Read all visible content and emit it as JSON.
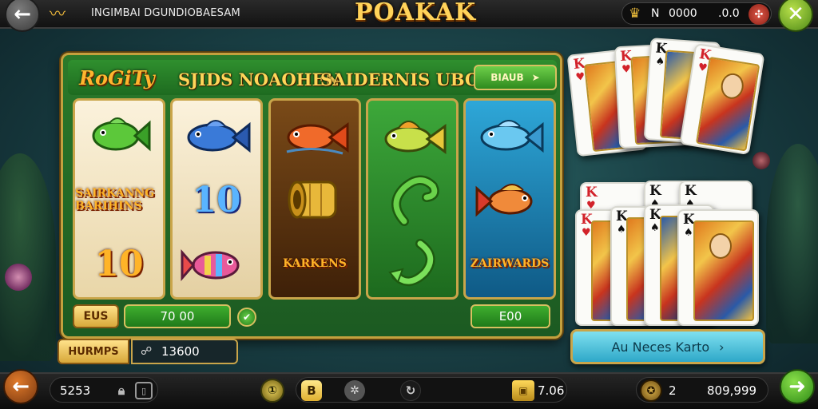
{
  "header": {
    "back_icon": "arrow-left-icon",
    "subtitle": "INGIMBAI DGUNDIOBAESAM",
    "title": "POAKAK",
    "balance_letter": "N",
    "balance_value": "0000",
    "balance_value2": ".0.0",
    "close_icon": "close-x-icon"
  },
  "panel": {
    "logo": "RoGiTy",
    "title": "SJIDS NOAOHEN",
    "title2": "SAIDERNIS UBOS",
    "menu_button": "BIAUB",
    "reels": [
      [
        "fish-green",
        "SAIRKANNG BARIHINS",
        "10"
      ],
      [
        "fish-blue",
        "10",
        "fish-rainbow"
      ],
      [
        "fish-orange",
        "gold-coin",
        "KARKENS"
      ],
      [
        "fish-yellow",
        "hook-green",
        "hook-green"
      ],
      [
        "fish-blue",
        "fish-red",
        "ZAIRWARDS"
      ]
    ],
    "bet_label": "EUS",
    "bet_value": "70 00",
    "win_value": "E00",
    "lower_label": "HURMPS",
    "lower_value": "13600"
  },
  "cards": {
    "rank": "K",
    "cta_label": "Au Neces Karto"
  },
  "footer": {
    "left_value": "5253",
    "b_label": "B",
    "chest_value": "7.06",
    "count_value": "2",
    "coins_value": "809,999"
  },
  "colors": {
    "accent_gold": "#ffd35a",
    "panel_green": "#2b7a2a",
    "cta_blue": "#2ea8c8"
  }
}
